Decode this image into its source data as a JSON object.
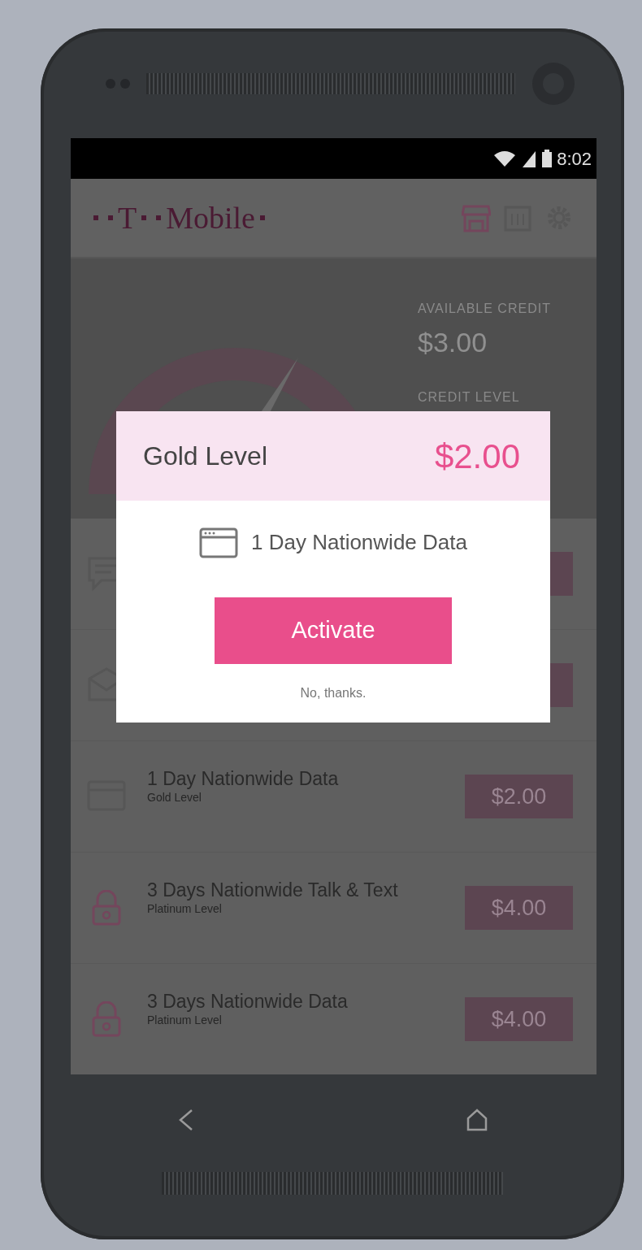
{
  "status_bar": {
    "time": "8:02"
  },
  "header": {
    "logo_letter": "T",
    "logo_word": "Mobile"
  },
  "credit": {
    "available_label": "AVAILABLE CREDIT",
    "available": "$3.00",
    "level_label": "CREDIT LEVEL"
  },
  "offers": [
    {
      "kind": "message"
    },
    {
      "kind": "mail"
    },
    {
      "kind": "data",
      "title": "1 Day Nationwide Data",
      "subtitle": "Gold Level",
      "price": "$2.00"
    },
    {
      "kind": "locked",
      "title": "3 Days Nationwide Talk & Text",
      "subtitle": "Platinum Level",
      "price": "$4.00"
    },
    {
      "kind": "locked",
      "title": "3 Days Nationwide Data",
      "subtitle": "Platinum Level",
      "price": "$4.00"
    }
  ],
  "dialog": {
    "title": "Gold Level",
    "price": "$2.00",
    "offer": "1 Day Nationwide Data",
    "action": "Activate",
    "dismiss": "No, thanks."
  }
}
